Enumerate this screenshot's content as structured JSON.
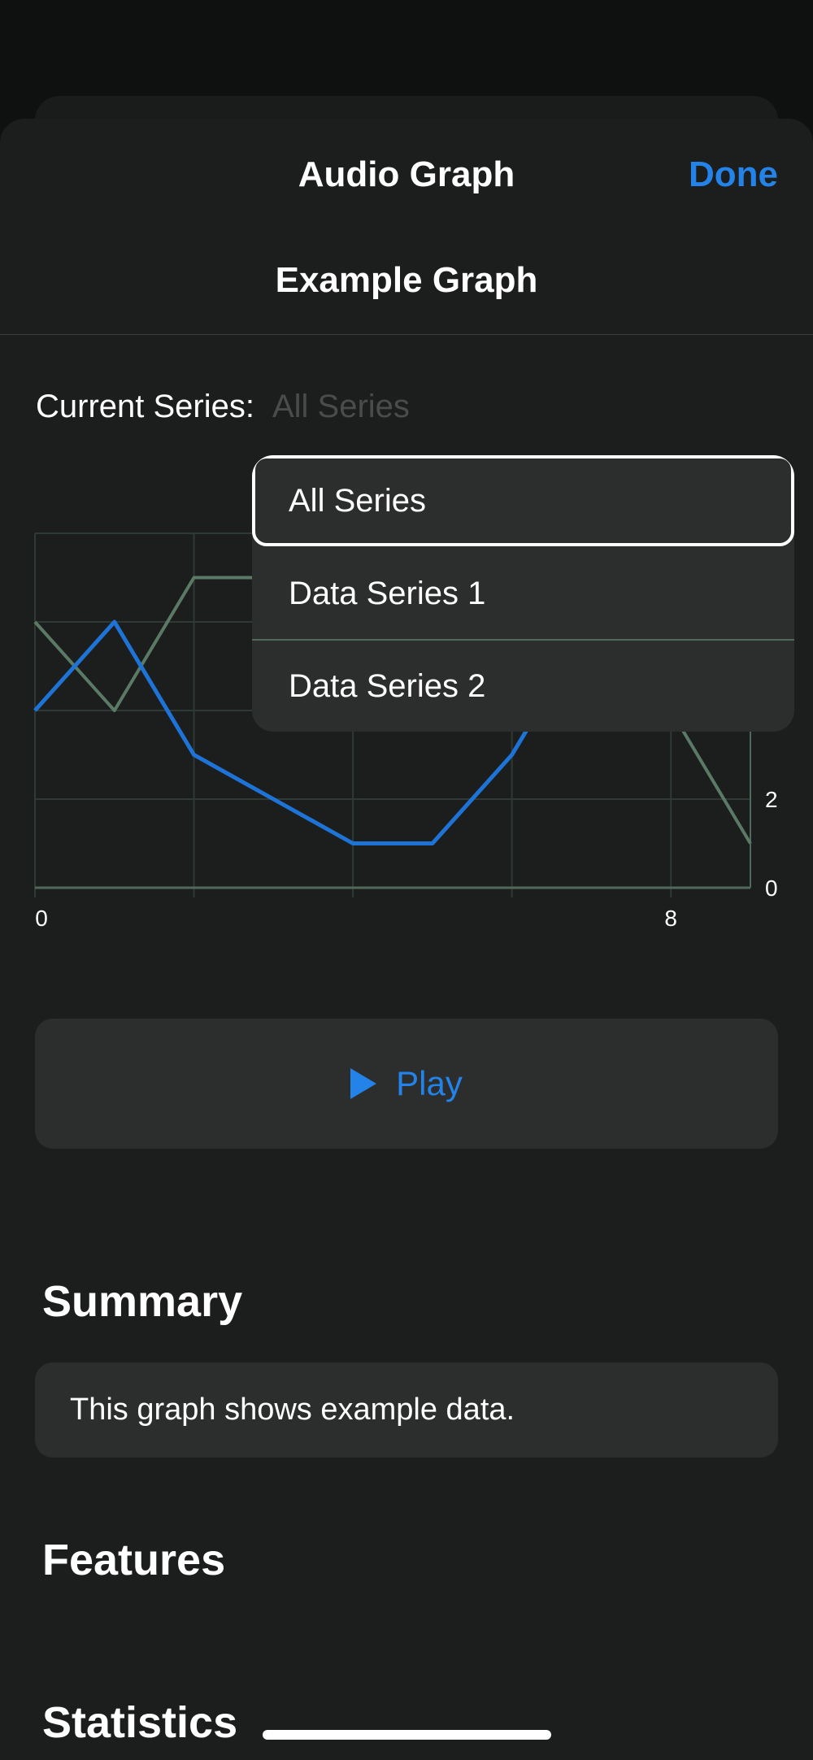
{
  "nav": {
    "title": "Audio Graph",
    "done_label": "Done"
  },
  "graph": {
    "title": "Example Graph"
  },
  "series_picker": {
    "label": "Current Series:",
    "value": "All Series",
    "options": [
      "All Series",
      "Data Series 1",
      "Data Series 2"
    ],
    "selected": "All Series"
  },
  "chart_data": {
    "type": "line",
    "title": "",
    "xlabel": "",
    "ylabel": "",
    "x_ticks": [
      "0",
      "8"
    ],
    "y_ticks": [
      "0",
      "2",
      "4"
    ],
    "xlim": [
      0,
      9
    ],
    "ylim": [
      0,
      8
    ],
    "grid": true,
    "series": [
      {
        "x": [
          0,
          1,
          2,
          3,
          4,
          5,
          6,
          7,
          8,
          9
        ],
        "values": [
          4,
          6,
          3,
          2,
          1,
          1,
          3,
          6,
          6,
          4
        ],
        "color": "#1e74d6"
      },
      {
        "x": [
          0,
          1,
          2,
          3,
          4,
          5,
          6,
          7,
          8,
          9
        ],
        "values": [
          6,
          4,
          7,
          7,
          7,
          7,
          7,
          7,
          4,
          1
        ],
        "color": "#5a7a66"
      }
    ]
  },
  "play": {
    "label": "Play"
  },
  "summary": {
    "heading": "Summary",
    "text": "This graph shows example data."
  },
  "features": {
    "heading": "Features"
  },
  "statistics": {
    "heading": "Statistics"
  }
}
